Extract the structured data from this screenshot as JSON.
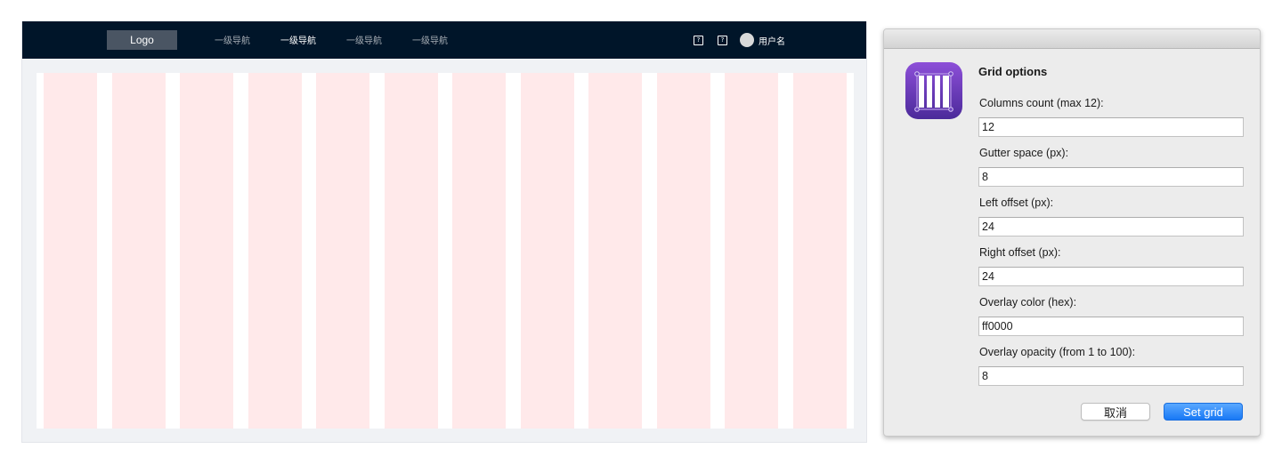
{
  "preview": {
    "logo": "Logo",
    "nav": [
      {
        "label": "一级导航",
        "active": false
      },
      {
        "label": "一级导航",
        "active": true
      },
      {
        "label": "一级导航",
        "active": false
      },
      {
        "label": "一级导航",
        "active": false
      }
    ],
    "help_glyph": "?",
    "username": "用户名",
    "colors": {
      "header_bg": "#001529",
      "page_bg": "#f0f2f5",
      "column_tint": "#ffe9ea"
    }
  },
  "dialog": {
    "title": "Grid options",
    "icon": "grid-columns-app-icon",
    "fields": [
      {
        "label": "Columns count (max 12):",
        "value": "12"
      },
      {
        "label": "Gutter space (px):",
        "value": "8"
      },
      {
        "label": "Left offset (px):",
        "value": "24"
      },
      {
        "label": "Right offset (px):",
        "value": "24"
      },
      {
        "label": "Overlay color (hex):",
        "value": "ff0000"
      },
      {
        "label": "Overlay opacity (from 1 to 100):",
        "value": "8"
      }
    ],
    "cancel_label": "取消",
    "submit_label": "Set grid",
    "colors": {
      "accent": "#1878f5",
      "icon_gradient_top": "#8d4fd8",
      "icon_gradient_bottom": "#4b2a9a"
    }
  }
}
